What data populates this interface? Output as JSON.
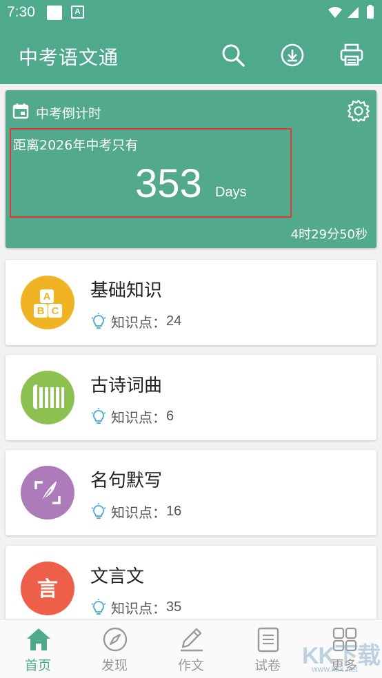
{
  "status_bar": {
    "time": "7:30"
  },
  "app_bar": {
    "title": "中考语文通"
  },
  "countdown": {
    "title": "中考倒计时",
    "subtitle": "距离2026年中考只有",
    "days": "353",
    "unit": "Days",
    "remaining": "4时29分50秒"
  },
  "categories": [
    {
      "name": "基础知识",
      "meta_label": "知识点：",
      "count": "24",
      "color": "#f0b323"
    },
    {
      "name": "古诗词曲",
      "meta_label": "知识点：",
      "count": "6",
      "color": "#8cc151"
    },
    {
      "name": "名句默写",
      "meta_label": "知识点：",
      "count": "16",
      "color": "#ad7bb9"
    },
    {
      "name": "文言文",
      "meta_label": "知识点：",
      "count": "35",
      "color": "#ed5f48"
    }
  ],
  "category_icons": {
    "block_letters": [
      "A",
      "B",
      "C"
    ],
    "glyph": "言"
  },
  "bottom_nav": [
    {
      "label": "首页",
      "icon": "home-icon",
      "active": true
    },
    {
      "label": "发现",
      "icon": "compass-icon",
      "active": false
    },
    {
      "label": "作文",
      "icon": "pencil-icon",
      "active": false
    },
    {
      "label": "试卷",
      "icon": "document-icon",
      "active": false
    },
    {
      "label": "更多",
      "icon": "grid-icon",
      "active": false
    }
  ],
  "watermark": {
    "text": "KK下载",
    "url": "www.kkx.net"
  },
  "colors": {
    "primary": "#4fa98c",
    "highlight_border": "#e53935",
    "bulb": "#3fa9d6"
  }
}
